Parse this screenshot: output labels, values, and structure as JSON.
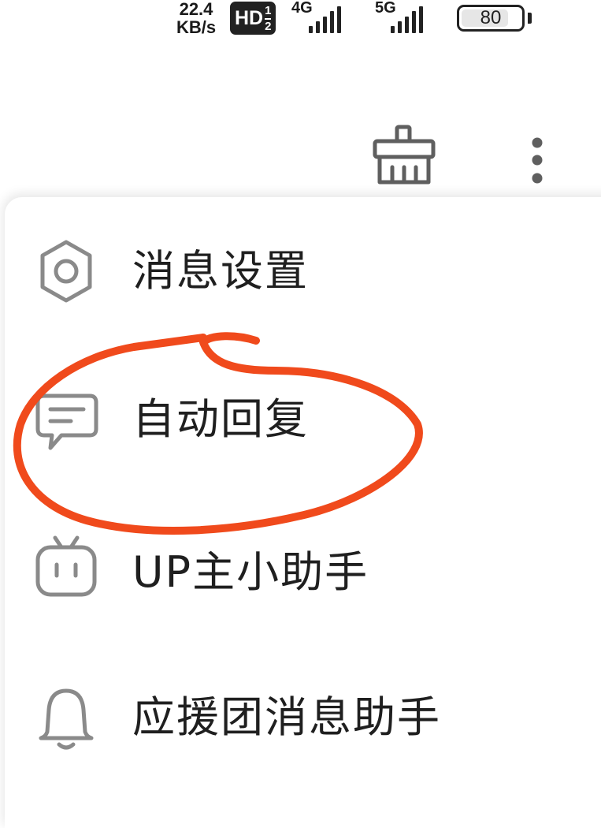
{
  "status_bar": {
    "net_speed_value": "22.4",
    "net_speed_unit": "KB/s",
    "hd_label": "HD",
    "hd_sim_top": "1",
    "hd_sim_bottom": "2",
    "sim1_network": "4G",
    "sim2_network": "5G",
    "battery_level": "80"
  },
  "toolbar": {
    "clear_icon": "broom-icon",
    "more_icon": "more-vertical-icon"
  },
  "menu": {
    "items": [
      {
        "label": "消息设置",
        "icon": "gear-icon"
      },
      {
        "label": "自动回复",
        "icon": "chat-bubble-icon"
      },
      {
        "label": "UP主小助手",
        "icon": "tv-robot-icon"
      },
      {
        "label": "应援团消息助手",
        "icon": "bell-icon"
      }
    ]
  },
  "colors": {
    "annotation": "#f04a1c",
    "icon": "#8a8a8a",
    "text": "#1f1f1f"
  }
}
